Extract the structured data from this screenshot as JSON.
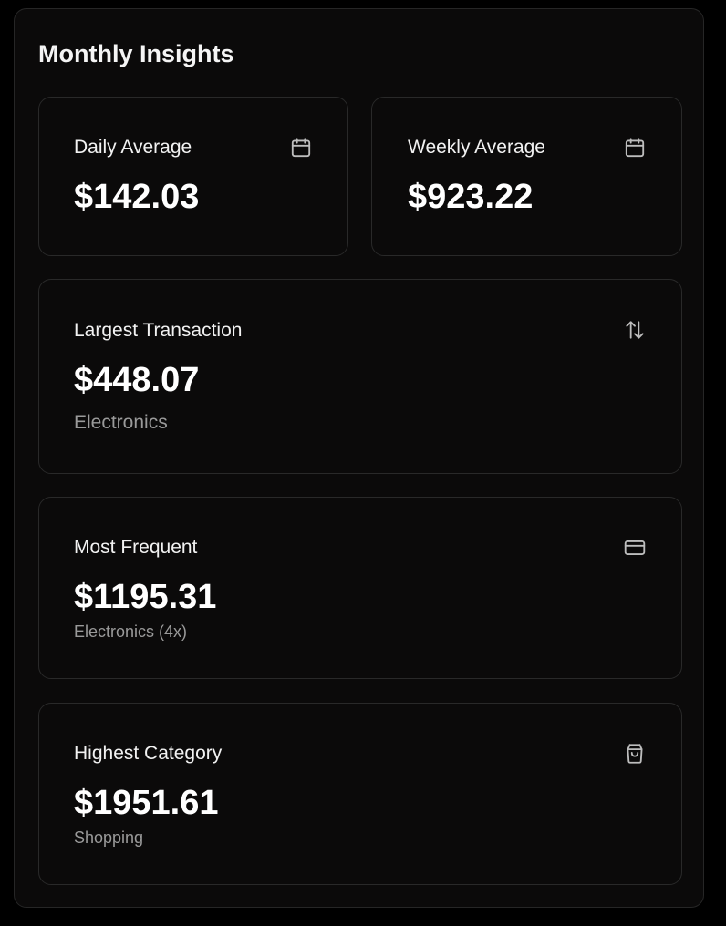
{
  "panel": {
    "title": "Monthly Insights"
  },
  "cards": {
    "daily": {
      "label": "Daily Average",
      "value": "$142.03",
      "icon": "calendar-icon"
    },
    "weekly": {
      "label": "Weekly Average",
      "value": "$923.22",
      "icon": "calendar-icon"
    },
    "largest": {
      "label": "Largest Transaction",
      "value": "$448.07",
      "sub": "Electronics",
      "icon": "arrows-up-down-icon"
    },
    "frequent": {
      "label": "Most Frequent",
      "value": "$1195.31",
      "sub": "Electronics (4x)",
      "icon": "credit-card-icon"
    },
    "category": {
      "label": "Highest Category",
      "value": "$1951.61",
      "sub": "Shopping",
      "icon": "shopping-bag-icon"
    }
  },
  "colors": {
    "background": "#000000",
    "panel": "#0b0a0a",
    "border": "#292929",
    "text": "#ffffff",
    "muted": "#9a9a9a",
    "icon": "#bdbdbd"
  }
}
